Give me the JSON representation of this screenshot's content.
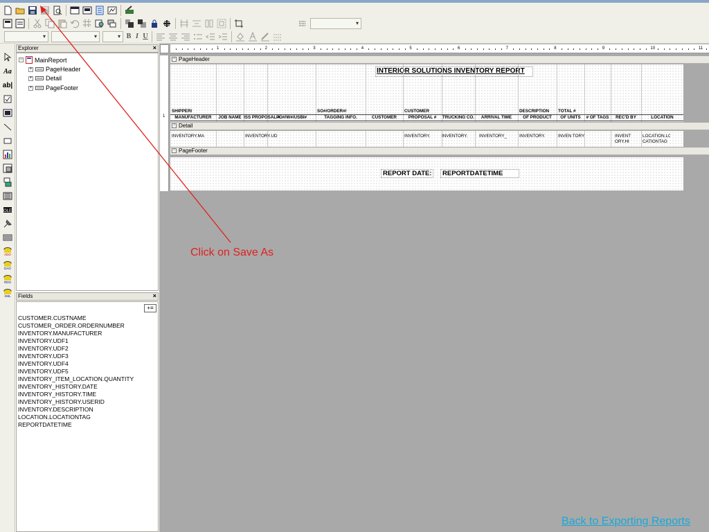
{
  "toolbar": {
    "row1_icons": [
      "new-file-icon",
      "open-folder-icon",
      "save-icon",
      "save-as-icon",
      "print-preview-icon",
      "window-icon",
      "layout-icon",
      "report-icon",
      "wizard-icon",
      "export-icon"
    ],
    "row2_icons": [
      "page-setup-icon",
      "properties-icon",
      "cut-icon",
      "copy-icon",
      "paste-icon",
      "undo-icon",
      "grid-icon",
      "find-icon",
      "layers-icon",
      "bring-front-icon",
      "send-back-icon",
      "lock-icon",
      "snap-icon",
      "align-icon",
      "spacing-icon",
      "size-icon",
      "group-icon",
      "crop-icon",
      "dots-icon"
    ],
    "row3_icons": [
      "align-left-icon",
      "align-center-icon",
      "align-right-icon",
      "bullets-icon",
      "outdent-icon",
      "indent-icon",
      "fill-color-icon",
      "font-color-icon",
      "line-color-icon",
      "border-icon"
    ],
    "font_bold": "B",
    "font_italic": "I",
    "font_underline": "U"
  },
  "left_tools": [
    "pointer-icon",
    "label-icon",
    "textbox-icon",
    "checkbox-icon",
    "image-icon",
    "line-icon",
    "rectangle-icon",
    "chart-icon",
    "subreport-icon",
    "page-break-icon",
    "barcode-icon",
    "rtf-icon",
    "ole-icon",
    "formula-icon",
    "ado-data-icon",
    "dao-data-icon",
    "rdo-data-icon",
    "xml-data-icon"
  ],
  "explorer": {
    "title": "Explorer",
    "close": "×",
    "root": "MainReport",
    "children": [
      "PageHeader",
      "Detail",
      "PageFooter"
    ]
  },
  "fields": {
    "title": "Fields",
    "close": "×",
    "items": [
      "CUSTOMER.CUSTNAME",
      "CUSTOMER_ORDER.ORDERNUMBER",
      "INVENTORY.MANUFACTURER",
      "INVENTORY.UDF1",
      "INVENTORY.UDF2",
      "INVENTORY.UDF3",
      "INVENTORY.UDF4",
      "INVENTORY.UDF5",
      "INVENTORY_ITEM_LOCATION.QUANTITY",
      "INVENTORY_HISTORY.DATE",
      "INVENTORY_HISTORY.TIME",
      "INVENTORY_HISTORY.USERID",
      "INVENTORY.DESCRIPTION",
      "LOCATION.LOCATIONTAG",
      "REPORTDATETIME"
    ]
  },
  "ruler": {
    "numbers": [
      "1",
      "2",
      "3",
      "4",
      "5",
      "6",
      "7",
      "8",
      "9",
      "10",
      "11"
    ],
    "left_marks": [
      "1"
    ]
  },
  "report": {
    "sections": {
      "page_header": "PageHeader",
      "detail": "Detail",
      "page_footer": "PageFooter"
    },
    "title": "INTERIOR SOLUTIONS INVENTORY REPORT",
    "header_columns": [
      {
        "line1": "SHIPPER/",
        "line2": "MANUFACTURER"
      },
      {
        "line1": "",
        "line2": "JOB NAME"
      },
      {
        "line1": "",
        "line2": "ISS PROPOSAL #"
      },
      {
        "line1": "",
        "line2": "PO#/W#/USBI#"
      },
      {
        "line1": "SO#/ORDER#/",
        "line2": "TAGGING INFO."
      },
      {
        "line1": "",
        "line2": "CUSTOMER"
      },
      {
        "line1": "CUSTOMER",
        "line2": "PROPOSAL #"
      },
      {
        "line1": "",
        "line2": "TRUCKING CO."
      },
      {
        "line1": "",
        "line2": "ARRIVAL TIME"
      },
      {
        "line1": "DESCRIPTION",
        "line2": "OF PRODUCT"
      },
      {
        "line1": "TOTAL #",
        "line2": "OF UNITS"
      },
      {
        "line1": "",
        "line2": "# OF TAGS"
      },
      {
        "line1": "",
        "line2": "REC'D BY"
      },
      {
        "line1": "",
        "line2": "LOCATION"
      }
    ],
    "detail_fields": [
      "INVENTORY.MA",
      "INVENTORY.UD",
      "INVENTORY.",
      "INVENTORY.",
      "INVENTORY_",
      "INVENTORY.",
      "INVEN TORY",
      "INVENT ORY.HI",
      "LOCATION.LO CATIONTAG"
    ],
    "footer_label": "REPORT DATE:",
    "footer_value": "REPORTDATETIME"
  },
  "annotation": "Click on Save As",
  "back_link": "Back to Exporting Reports",
  "colors": {
    "annotation": "#e0201e",
    "link": "#18a8d8",
    "canvas": "#a9a9a9"
  }
}
